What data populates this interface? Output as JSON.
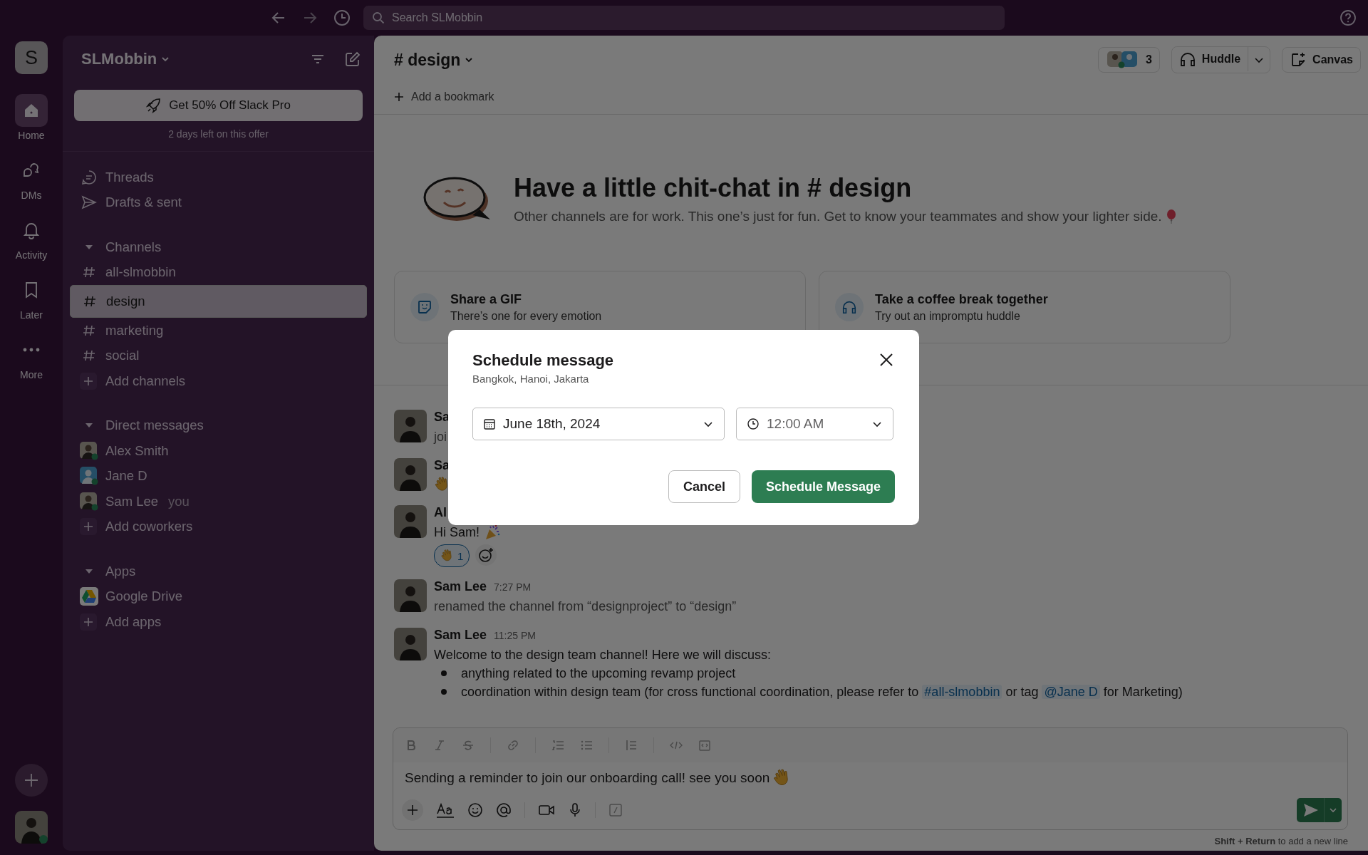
{
  "search": {
    "placeholder": "Search SLMobbin"
  },
  "rail": {
    "workspace_initial": "S",
    "items": [
      {
        "label": "Home",
        "kind": "home",
        "selected": true
      },
      {
        "label": "DMs",
        "kind": "dms",
        "selected": false
      },
      {
        "label": "Activity",
        "kind": "activity",
        "selected": false
      },
      {
        "label": "Later",
        "kind": "later",
        "selected": false
      },
      {
        "label": "More",
        "kind": "more",
        "selected": false
      }
    ]
  },
  "sidebar": {
    "workspace": "SLMobbin",
    "promo": {
      "button": "Get 50% Off Slack Pro",
      "note": "2 days left on this offer"
    },
    "nav": [
      {
        "label": "Threads",
        "kind": "threads"
      },
      {
        "label": "Drafts & sent",
        "kind": "drafts"
      }
    ],
    "sections": [
      {
        "title": "Channels",
        "expanded": true,
        "items": [
          {
            "kind": "channel",
            "label": "all-slmobbin",
            "selected": false
          },
          {
            "kind": "channel",
            "label": "design",
            "selected": true
          },
          {
            "kind": "channel",
            "label": "marketing",
            "selected": false
          },
          {
            "kind": "channel",
            "label": "social",
            "selected": false
          },
          {
            "kind": "add",
            "label": "Add channels",
            "selected": false
          }
        ]
      },
      {
        "title": "Direct messages",
        "expanded": true,
        "items": [
          {
            "kind": "person",
            "label": "Alex Smith",
            "selected": false
          },
          {
            "kind": "person",
            "label": "Jane D",
            "selected": false
          },
          {
            "kind": "person",
            "label": "Sam Lee",
            "note": "you",
            "selected": false
          },
          {
            "kind": "add",
            "label": "Add coworkers",
            "selected": false
          }
        ]
      },
      {
        "title": "Apps",
        "expanded": true,
        "items": [
          {
            "kind": "app",
            "label": "Google Drive",
            "selected": false
          },
          {
            "kind": "add",
            "label": "Add apps",
            "selected": false
          }
        ]
      }
    ]
  },
  "channel": {
    "name": "# design",
    "members": "3",
    "huddle": "Huddle",
    "canvas": "Canvas",
    "bookmark": "Add a bookmark"
  },
  "intro": {
    "title": "Have a little chit-chat in # design",
    "subtitle": "Other channels are for work. This one’s just for fun. Get to know your teammates and show your lighter side."
  },
  "cards": [
    {
      "kind": "gif",
      "title": "Share a GIF",
      "subtitle": "There’s one for every emotion"
    },
    {
      "kind": "huddle",
      "title": "Take a coffee break together",
      "subtitle": "Try out an impromptu huddle"
    }
  ],
  "messages": [
    {
      "author": "Sa",
      "text": "joi",
      "kind": "joined"
    },
    {
      "author": "Sa",
      "kind": "wave"
    },
    {
      "author": "Al",
      "text": "Hi Sam!",
      "kind": "greeting",
      "reactions": [
        {
          "count": "1",
          "selected": true
        }
      ]
    },
    {
      "author": "Sam Lee",
      "time": "7:27 PM",
      "text": "renamed the channel from “designproject” to “design”",
      "kind": "renamed"
    },
    {
      "author": "Sam Lee",
      "time": "11:25 PM",
      "text": "Welcome to the design team channel! Here we will discuss:",
      "kind": "post",
      "bullets": [
        [
          {
            "text": "anything related to the upcoming revamp project"
          }
        ],
        [
          {
            "text": "coordination within design team (for cross functional coordination, please refer to "
          },
          {
            "link": "#all-slmobbin"
          },
          {
            "text": " or tag "
          },
          {
            "link": "@Jane D"
          },
          {
            "text": " for Marketing)"
          }
        ]
      ]
    }
  ],
  "composer": {
    "value": "Sending a reminder to join our onboarding call! see you soon",
    "hint": "**Shift + Return** to add a new line"
  },
  "modal": {
    "title": "Schedule message",
    "subtitle": "Bangkok, Hanoi, Jakarta",
    "date": "June 18th, 2024",
    "time": "12:00 AM",
    "buttons": [
      {
        "label": "Cancel",
        "kind": "secondary"
      },
      {
        "label": "Schedule Message",
        "kind": "primary"
      }
    ]
  }
}
